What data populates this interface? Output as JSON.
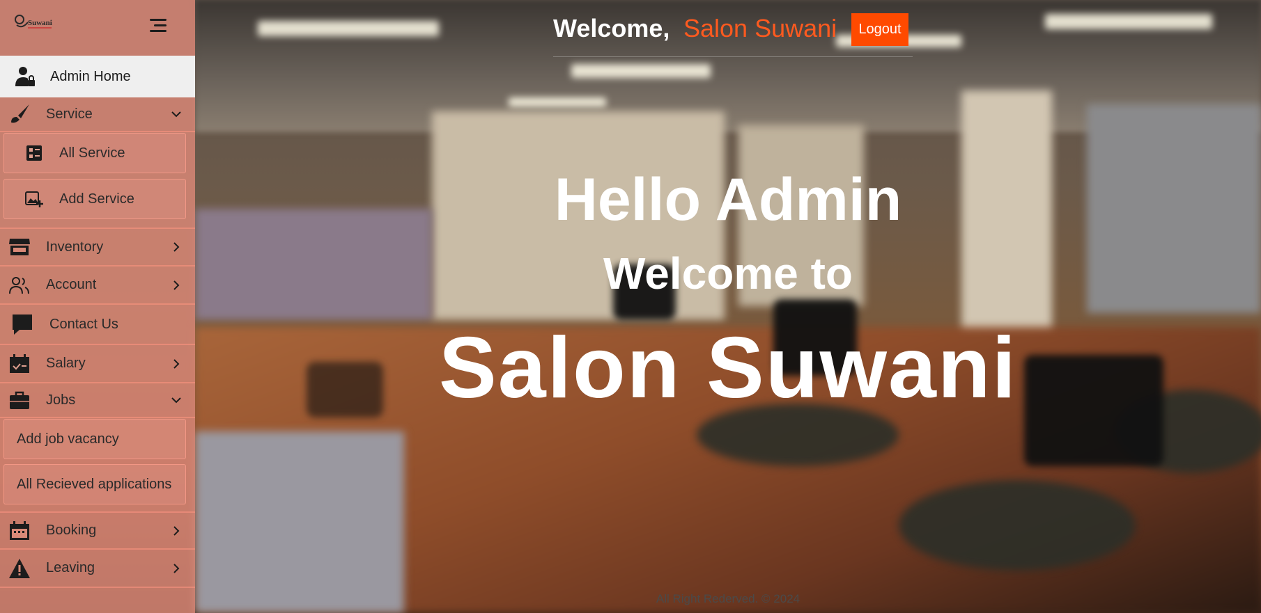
{
  "header": {
    "welcome_prefix": "Welcome,",
    "welcome_name": "Salon Suwani",
    "logout_label": "Logout"
  },
  "sidebar": {
    "logo_icon": "salon-suwani-logo",
    "menu_icon": "hamburger-menu-icon",
    "items": [
      {
        "label": "Admin Home",
        "icon": "user-lock-icon",
        "active": true
      },
      {
        "label": "Service",
        "icon": "brush-icon",
        "chevron": "down",
        "children": [
          {
            "label": "All Service",
            "icon": "list-icon"
          },
          {
            "label": "Add Service",
            "icon": "add-image-icon"
          }
        ]
      },
      {
        "label": "Inventory",
        "icon": "store-icon",
        "chevron": "right"
      },
      {
        "label": "Account",
        "icon": "users-icon",
        "chevron": "right"
      },
      {
        "label": "Contact Us",
        "icon": "chat-icon"
      },
      {
        "label": "Salary",
        "icon": "calendar-check-icon",
        "chevron": "right"
      },
      {
        "label": "Jobs",
        "icon": "briefcase-icon",
        "chevron": "down",
        "children": [
          {
            "label": "Add job vacancy"
          },
          {
            "label": "All Recieved applications"
          }
        ]
      },
      {
        "label": "Booking",
        "icon": "calendar-icon",
        "chevron": "right"
      },
      {
        "label": "Leaving",
        "icon": "warning-icon",
        "chevron": "right"
      }
    ]
  },
  "hero": {
    "line1": "Hello Admin",
    "line2": "Welcome to",
    "line3": "Salon Suwani"
  },
  "footer": {
    "text": "All Right Rederved. © 2024"
  },
  "colors": {
    "accent": "#ff4a00",
    "name_highlight": "#ff5a1f",
    "sidebar_bg": "#d68676",
    "active_item_bg": "#efefef"
  }
}
